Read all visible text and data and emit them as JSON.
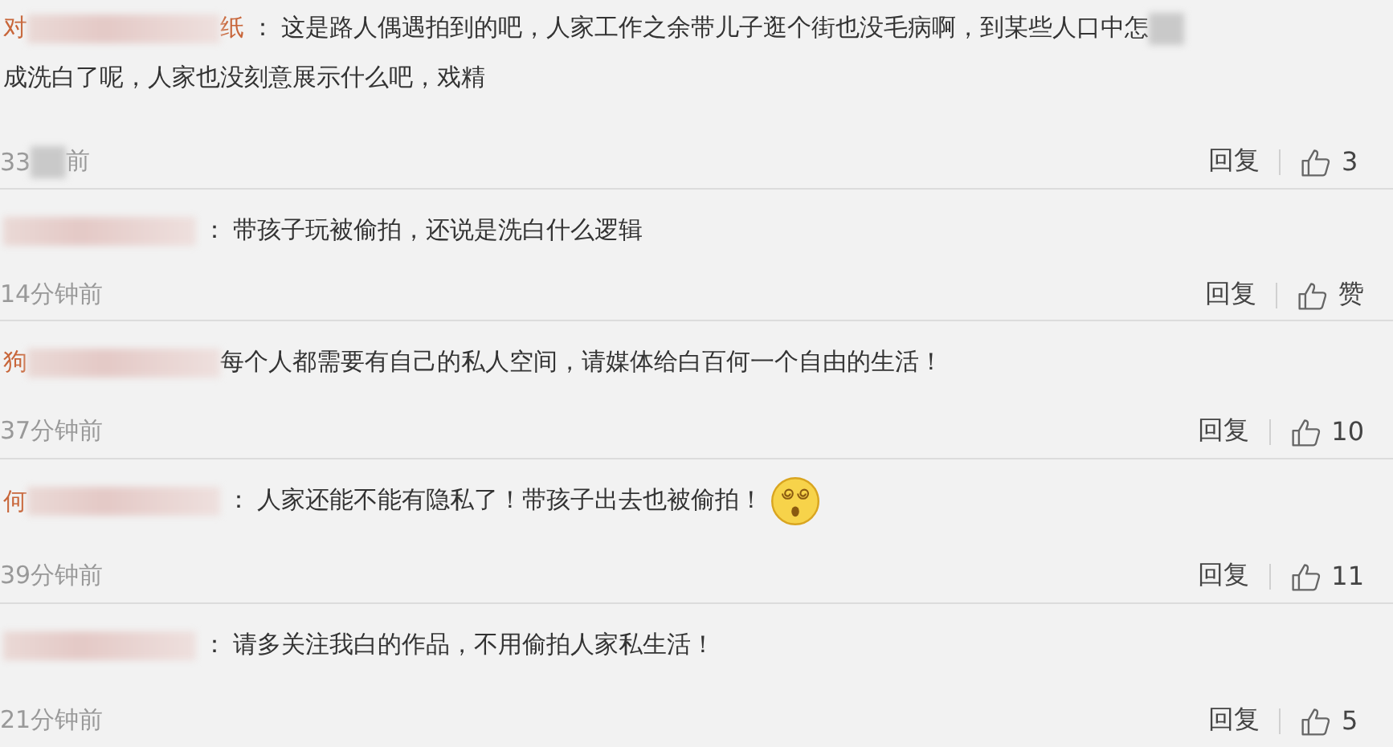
{
  "comments": [
    {
      "name": [
        {
          "kind": "text",
          "text": "对"
        },
        {
          "kind": "blur"
        },
        {
          "kind": "text",
          "text": "纸"
        }
      ],
      "separator": "：",
      "body": [
        {
          "kind": "text",
          "text": "这是路人偶遇拍到的吧，人家工作之余带儿子逛个街也没毛病啊，到某些人口中"
        },
        {
          "kind": "text",
          "text": "怎"
        },
        {
          "kind": "blur"
        },
        {
          "kind": "text",
          "text": "成洗白了呢，人家也没刻意展示什么吧，戏精"
        }
      ],
      "time": [
        {
          "kind": "text",
          "text": "33"
        },
        {
          "kind": "blur"
        },
        {
          "kind": "text",
          "text": "前"
        }
      ],
      "reply": "回复",
      "likes": "3"
    },
    {
      "name": [
        {
          "kind": "blur"
        }
      ],
      "separator": "：",
      "body": [
        {
          "kind": "text",
          "text": "带孩子玩被偷拍，还说是洗白什么逻辑"
        }
      ],
      "time": [
        {
          "kind": "text",
          "text": "14分钟前"
        }
      ],
      "reply": "回复",
      "likes": "赞"
    },
    {
      "name": [
        {
          "kind": "text",
          "text": "狗"
        },
        {
          "kind": "blur"
        }
      ],
      "body": [
        {
          "kind": "text",
          "text": "每个人都需要有自己的私人空间，请媒体给白百何一个自由的生活！"
        }
      ],
      "time": [
        {
          "kind": "text",
          "text": "37分钟前"
        }
      ],
      "reply": "回复",
      "likes": "10"
    },
    {
      "name": [
        {
          "kind": "text",
          "text": "何"
        },
        {
          "kind": "blur"
        }
      ],
      "separator": "：",
      "body": [
        {
          "kind": "text",
          "text": "人家还能不能有隐私了！带孩子出去也被偷拍！"
        },
        {
          "kind": "emoji"
        }
      ],
      "time": [
        {
          "kind": "text",
          "text": "39分钟前"
        }
      ],
      "reply": "回复",
      "likes": "11"
    },
    {
      "name": [
        {
          "kind": "blur"
        }
      ],
      "separator": "：",
      "body": [
        {
          "kind": "text",
          "text": "请多关注我白的作品，不用偷拍人家私生活！"
        }
      ],
      "time": [
        {
          "kind": "text",
          "text": "21分钟前"
        }
      ],
      "reply": "回复",
      "likes": "5"
    }
  ]
}
